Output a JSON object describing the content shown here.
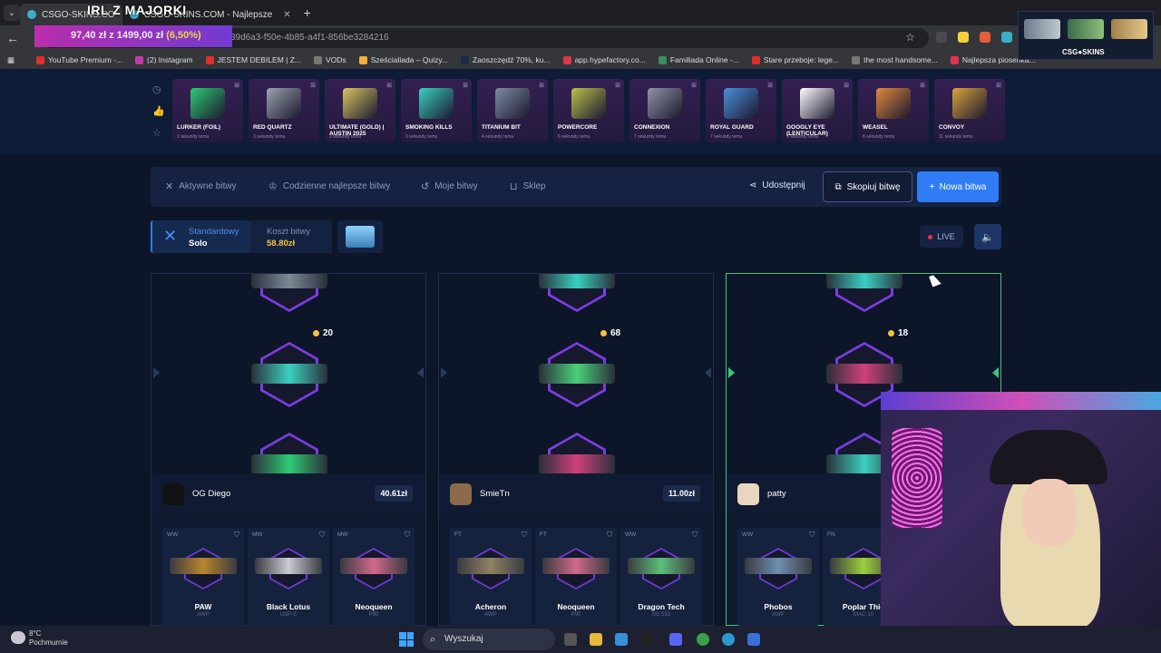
{
  "browser": {
    "overlay_title": "IRL Z MAJORKI",
    "tabs": [
      {
        "label": "CSGO-SKINS.CO"
      },
      {
        "label": "CSGO-SKINS.COM - Najlepsze"
      }
    ],
    "new_tab": "+",
    "url": "39d6a3-f50e-4b85-a4f1-856be3284216",
    "progress": {
      "amount": "97,40 zł",
      "of": "z",
      "goal": "1499,00 zł",
      "pct": "(6,50%)",
      "fraction": 0.065
    },
    "bookmarks": [
      "YouTube Premium -...",
      "(2) Instagram",
      "JESTEM DEBILEM | Z...",
      "VODs",
      "Sześcialiada – Quizy...",
      "Zaoszczędź 70%, ku...",
      "app.hypefactory.co...",
      "Familiada Online -...",
      "Stare przeboje: lege...",
      "the most handsome...",
      "Najlepsza piosenka..."
    ],
    "stream_label": "CSG●SKINS"
  },
  "top_skins": [
    {
      "name": "LURKER (FOIL)",
      "time": "1 sekundy temu",
      "color": "#2ecc71"
    },
    {
      "name": "RED QUARTZ",
      "time": "3 sekundy temu",
      "color": "#9aa3ad"
    },
    {
      "name": "ULTIMATE (GOLD) | AUSTIN 2025",
      "time": "3 sekundy temu",
      "color": "#d8c560"
    },
    {
      "name": "SMOKING KILLS",
      "time": "3 sekundy temu",
      "color": "#3ad0c0"
    },
    {
      "name": "TITANIUM BIT",
      "time": "4 sekundy temu",
      "color": "#7c8c9e"
    },
    {
      "name": "POWERCORE",
      "time": "6 sekundy temu",
      "color": "#b9c24a"
    },
    {
      "name": "CONNEXION",
      "time": "7 sekundy temu",
      "color": "#8f96a5"
    },
    {
      "name": "ROYAL GUARD",
      "time": "7 sekundy temu",
      "color": "#4a90d9"
    },
    {
      "name": "GOOGLY EYE (LENTICULAR)",
      "time": "7 sekundy temu",
      "color": "#ffffff"
    },
    {
      "name": "WEASEL",
      "time": "8 sekundy temu",
      "color": "#e08a3a"
    },
    {
      "name": "CONVOY",
      "time": "11 sekundy temu",
      "color": "#d9a33a"
    }
  ],
  "nav": {
    "items": [
      "Aktywne bitwy",
      "Codzienne najlepsze bitwy",
      "Moje bitwy",
      "Sklep"
    ],
    "share": "Udostępnij",
    "copy": "Skopiuj bitwę",
    "new_battle": "Nowa bitwa"
  },
  "battle": {
    "mode_title": "Standardowy",
    "mode_sub": "Solo",
    "cost_label": "Koszt bitwy",
    "cost_value": "58.80zł",
    "live": "LIVE"
  },
  "players": [
    {
      "name": "OG Diego",
      "total": "40.61zł",
      "reel_price": "20",
      "winner": false,
      "items": [
        {
          "cond": "WW",
          "name": "PAW",
          "type": "AWP",
          "color": "#b7862f"
        },
        {
          "cond": "MW",
          "name": "Black Lotus",
          "type": "USP-S",
          "color": "#c9ccd1"
        },
        {
          "cond": "MW",
          "name": "Neoqueen",
          "type": "P90",
          "color": "#d06a8a"
        }
      ]
    },
    {
      "name": "SmieTn",
      "total": "11.00zł",
      "reel_price": "68",
      "winner": false,
      "items": [
        {
          "cond": "FT",
          "name": "Acheron",
          "type": "AWP",
          "color": "#8f8266"
        },
        {
          "cond": "FT",
          "name": "Neoqueen",
          "type": "P90",
          "color": "#d06a8a"
        },
        {
          "cond": "WW",
          "name": "Dragon Tech",
          "type": "SG 553",
          "color": "#5cbf7a"
        }
      ]
    },
    {
      "name": "patty",
      "total": "",
      "reel_price": "18",
      "winner": true,
      "items": [
        {
          "cond": "WW",
          "name": "Phobos",
          "type": "AWP",
          "color": "#6f8fb0"
        },
        {
          "cond": "FN",
          "name": "Poplar Thic",
          "type": "MAC-10",
          "color": "#9ccf3a"
        }
      ]
    }
  ],
  "taskbar": {
    "temp": "8°C",
    "weather": "Pochmurnie",
    "search": "Wyszukaj"
  }
}
